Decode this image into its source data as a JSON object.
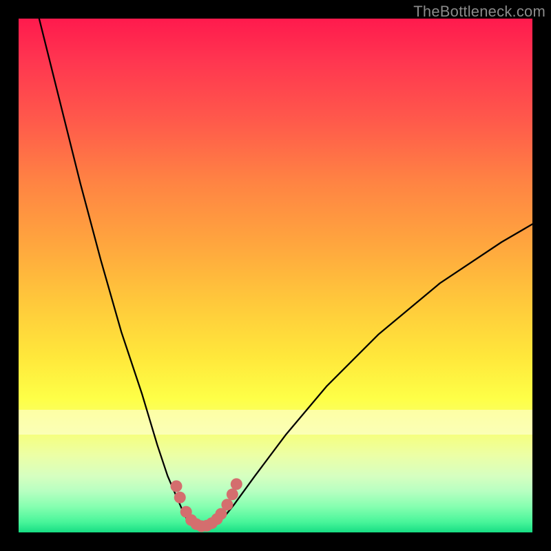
{
  "watermark": "TheBottleneck.com",
  "chart_data": {
    "type": "line",
    "title": "",
    "xlabel": "",
    "ylabel": "",
    "xlim": [
      0,
      100
    ],
    "ylim": [
      0,
      100
    ],
    "grid": false,
    "series": [
      {
        "name": "left-curve",
        "x": [
          4,
          8,
          12,
          16,
          20,
          24,
          27,
          29,
          30.5,
          31.5,
          32.2,
          32.8,
          33.2
        ],
        "y": [
          100,
          84,
          68,
          53,
          39,
          27,
          17,
          11,
          7.5,
          5.2,
          3.6,
          2.5,
          2.0
        ]
      },
      {
        "name": "valley-floor",
        "x": [
          33.2,
          34.0,
          35.0,
          36.0,
          37.0,
          38.0,
          38.8
        ],
        "y": [
          2.0,
          1.4,
          1.1,
          1.0,
          1.1,
          1.4,
          2.0
        ]
      },
      {
        "name": "right-curve",
        "x": [
          38.8,
          40.0,
          42.0,
          46.0,
          52.0,
          60.0,
          70.0,
          82.0,
          94.0,
          100.0
        ],
        "y": [
          2.0,
          3.0,
          5.5,
          11.0,
          19.0,
          28.5,
          38.5,
          48.5,
          56.5,
          60.0
        ]
      }
    ],
    "markers": {
      "name": "valley-markers",
      "color": "#d46e6e",
      "points_xy": [
        [
          30.7,
          9.0
        ],
        [
          31.4,
          6.8
        ],
        [
          32.6,
          4.0
        ],
        [
          33.6,
          2.4
        ],
        [
          34.6,
          1.6
        ],
        [
          35.6,
          1.2
        ],
        [
          36.6,
          1.3
        ],
        [
          37.6,
          1.8
        ],
        [
          38.6,
          2.6
        ],
        [
          39.4,
          3.6
        ],
        [
          40.6,
          5.4
        ],
        [
          41.6,
          7.4
        ],
        [
          42.4,
          9.4
        ]
      ]
    }
  }
}
